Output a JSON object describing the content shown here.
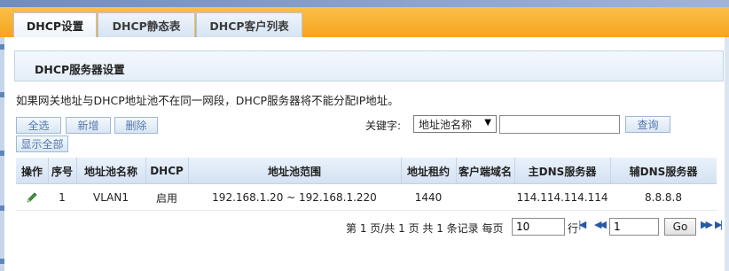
{
  "tabs": [
    {
      "label": "DHCP设置",
      "active": true
    },
    {
      "label": "DHCP静态表",
      "active": false
    },
    {
      "label": "DHCP客户列表",
      "active": false
    }
  ],
  "panel": {
    "title": "DHCP服务器设置"
  },
  "notice": "如果网关地址与DHCP地址池不在同一网段，DHCP服务器将不能分配IP地址。",
  "toolbar": {
    "select_all": "全选",
    "add": "新增",
    "delete": "删除",
    "show_all": "显示全部",
    "keyword_label": "关键字:",
    "keyword_field": "地址池名称",
    "keyword_value": "",
    "query": "查询"
  },
  "table": {
    "headers": [
      "操作",
      "序号",
      "地址池名称",
      "DHCP",
      "地址池范围",
      "地址租约",
      "客户端域名",
      "主DNS服务器",
      "辅DNS服务器"
    ],
    "rows": [
      {
        "action_icon": "pencil-edit-icon",
        "index": "1",
        "pool_name": "VLAN1",
        "dhcp": "启用",
        "range": "192.168.1.20 ~ 192.168.1.220",
        "lease": "1440",
        "client_domain": "",
        "primary_dns": "114.114.114.114",
        "secondary_dns": "8.8.8.8"
      }
    ]
  },
  "pager": {
    "summary": "第 1 页/共 1 页 共 1 条记录 每页",
    "per_page": "10",
    "rows_label": "行",
    "page_input": "1",
    "go": "Go",
    "first_icon": "first-page-icon",
    "prev_icon": "prev-page-icon",
    "next_icon": "next-page-icon",
    "last_icon": "last-page-icon"
  },
  "colors": {
    "tab_bar": "#f6a51c",
    "accent_blue": "#5577aa",
    "edit_icon": "#2e8b2e"
  }
}
